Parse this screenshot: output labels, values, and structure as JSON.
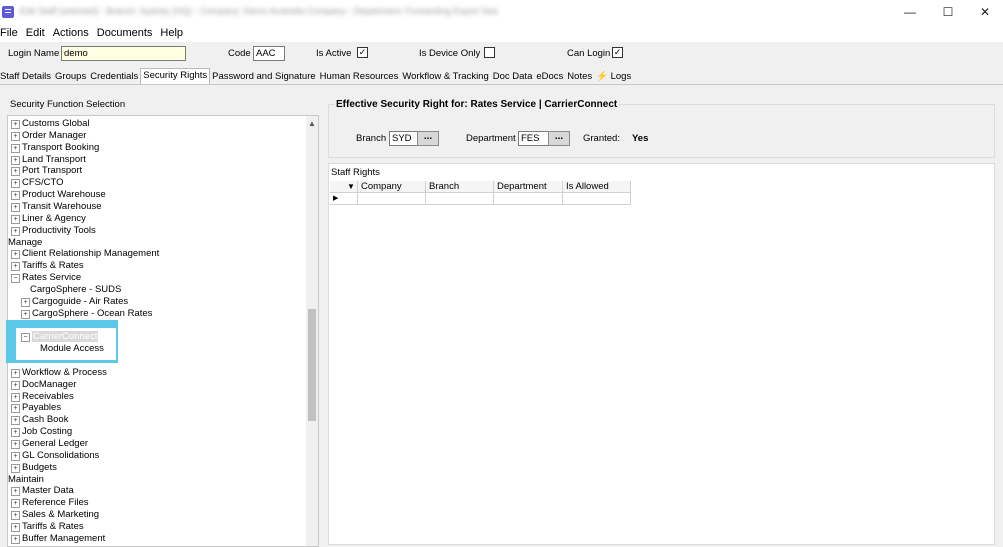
{
  "window": {
    "title": "Edit Staff (selected) - Branch: Sydney (HQ) - Company: Demo Australia Company - Department: Forwarding Export Sea",
    "controls": [
      "—",
      "☐",
      "✕"
    ]
  },
  "menu": [
    "File",
    "Edit",
    "Actions",
    "Documents",
    "Help"
  ],
  "fields": {
    "login_name_label": "Login Name",
    "login_name_value": "demo",
    "code_label": "Code",
    "code_value": "AAC",
    "is_active_label": "Is Active",
    "is_active_checked": "✓",
    "is_device_only_label": "Is Device Only",
    "can_login_label": "Can Login",
    "can_login_checked": "✓"
  },
  "tabs": [
    "Staff Details",
    "Groups",
    "Credentials",
    "Security Rights",
    "Password and Signature",
    "Human Resources",
    "Workflow & Tracking",
    "Doc Data",
    "eDocs",
    "Notes",
    "⚡ Logs"
  ],
  "left": {
    "title": "Security Function Selection",
    "tree": [
      {
        "label": "Customs Global",
        "indent": 0,
        "expander": "+"
      },
      {
        "label": "Order Manager",
        "indent": 0,
        "expander": "+"
      },
      {
        "label": "Transport Booking",
        "indent": 0,
        "expander": "+"
      },
      {
        "label": "Land Transport",
        "indent": 0,
        "expander": "+"
      },
      {
        "label": "Port Transport",
        "indent": 0,
        "expander": "+"
      },
      {
        "label": "CFS/CTO",
        "indent": 0,
        "expander": "+"
      },
      {
        "label": "Product Warehouse",
        "indent": 0,
        "expander": "+"
      },
      {
        "label": "Transit Warehouse",
        "indent": 0,
        "expander": "+"
      },
      {
        "label": "Liner & Agency",
        "indent": 0,
        "expander": "+"
      },
      {
        "label": "Productivity Tools",
        "indent": 0,
        "expander": "+"
      },
      {
        "label": "Manage",
        "indent": -1,
        "expander": ""
      },
      {
        "label": "Client Relationship Management",
        "indent": 0,
        "expander": "+"
      },
      {
        "label": "Tariffs & Rates",
        "indent": 0,
        "expander": "+"
      },
      {
        "label": "Rates Service",
        "indent": 0,
        "expander": "−"
      },
      {
        "label": "CargoSphere - SUDS",
        "indent": 1,
        "expander": ""
      },
      {
        "label": "Cargoguide - Air Rates",
        "indent": 1,
        "expander": "+"
      },
      {
        "label": "CargoSphere - Ocean Rates",
        "indent": 1,
        "expander": "+"
      },
      {
        "label": "",
        "indent": 0,
        "expander": ""
      },
      {
        "label": "CarrierConnect",
        "indent": 1,
        "expander": "−"
      },
      {
        "label": "Module Access",
        "indent": 2,
        "expander": ""
      },
      {
        "label": "",
        "indent": 0,
        "expander": ""
      },
      {
        "label": "Workflow & Process",
        "indent": 0,
        "expander": "+"
      },
      {
        "label": "DocManager",
        "indent": 0,
        "expander": "+"
      },
      {
        "label": "Receivables",
        "indent": 0,
        "expander": "+"
      },
      {
        "label": "Payables",
        "indent": 0,
        "expander": "+"
      },
      {
        "label": "Cash Book",
        "indent": 0,
        "expander": "+"
      },
      {
        "label": "Job Costing",
        "indent": 0,
        "expander": "+"
      },
      {
        "label": "General Ledger",
        "indent": 0,
        "expander": "+"
      },
      {
        "label": "GL Consolidations",
        "indent": 0,
        "expander": "+"
      },
      {
        "label": "Budgets",
        "indent": 0,
        "expander": "+"
      },
      {
        "label": "Maintain",
        "indent": -1,
        "expander": ""
      },
      {
        "label": "Master Data",
        "indent": 0,
        "expander": "+"
      },
      {
        "label": "Reference Files",
        "indent": 0,
        "expander": "+"
      },
      {
        "label": "Sales & Marketing",
        "indent": 0,
        "expander": "+"
      },
      {
        "label": "Tariffs & Rates",
        "indent": 0,
        "expander": "+"
      },
      {
        "label": "Buffer Management",
        "indent": 0,
        "expander": "+"
      }
    ]
  },
  "right": {
    "effective_title": "Effective Security Right for: Rates Service | CarrierConnect",
    "branch_label": "Branch",
    "branch_value": "SYD",
    "department_label": "Department",
    "department_value": "FES",
    "granted_label": "Granted:",
    "granted_value": "Yes",
    "lookup_label": "...",
    "staff_rights_label": "Staff Rights",
    "columns": [
      "Company",
      "Branch",
      "Department",
      "Is Allowed"
    ],
    "sort_indicator": "▼",
    "row_indicator": "▶"
  }
}
